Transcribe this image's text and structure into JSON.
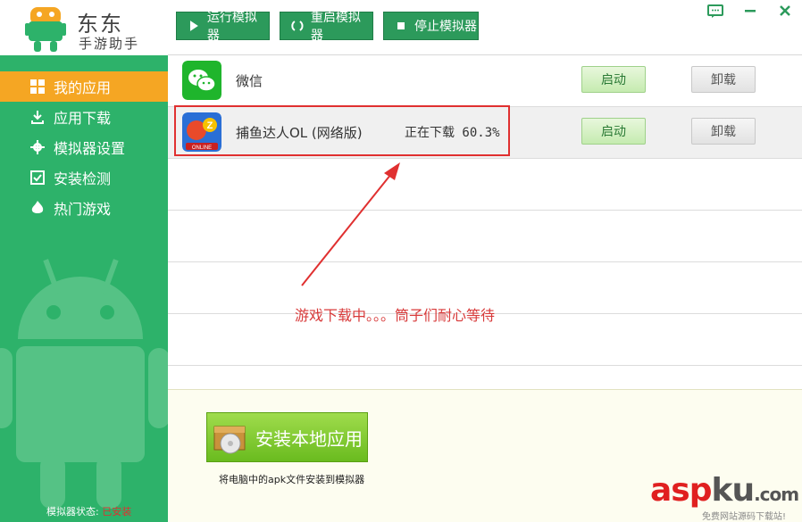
{
  "app": {
    "title": "东东",
    "subtitle": "手游助手"
  },
  "toolbar": {
    "run_label": "运行模拟器",
    "restart_label": "重启模拟器",
    "stop_label": "停止模拟器"
  },
  "sidebar": {
    "items": [
      {
        "label": "我的应用",
        "icon": "grid-icon",
        "active": true
      },
      {
        "label": "应用下载",
        "icon": "download-icon"
      },
      {
        "label": "模拟器设置",
        "icon": "gear-icon"
      },
      {
        "label": "安装检测",
        "icon": "checkbox-icon"
      },
      {
        "label": "热门游戏",
        "icon": "hot-icon"
      }
    ],
    "status_label": "模拟器状态:",
    "status_value": "已安装"
  },
  "apps": [
    {
      "name": "微信",
      "status": "",
      "start_label": "启动",
      "uninstall_label": "卸载",
      "icon": "wechat-icon"
    },
    {
      "name": "捕鱼达人OL (网络版)",
      "status": "正在下载 60.3%",
      "start_label": "启动",
      "uninstall_label": "卸载",
      "icon": "fishing-game-icon"
    }
  ],
  "annotation": "游戏下载中。。。筒子们耐心等待",
  "install": {
    "button_label": "安装本地应用",
    "hint": "将电脑中的apk文件安装到模拟器"
  },
  "watermark": {
    "main_a": "asp",
    "main_k": "ku",
    "main_dot": ".com",
    "sub": "免费网站源码下载站!"
  },
  "colors": {
    "sidebar": "#2db26a",
    "active": "#f5a623",
    "toolbar_button": "#2c9a5b",
    "annotation": "#d83a3a"
  }
}
